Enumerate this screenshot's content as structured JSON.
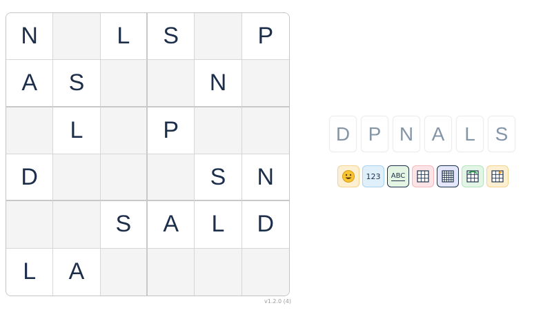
{
  "grid": [
    [
      "N",
      "",
      "L",
      "S",
      "",
      "P"
    ],
    [
      "A",
      "S",
      "",
      "",
      "N",
      ""
    ],
    [
      "",
      "L",
      "",
      "P",
      "",
      ""
    ],
    [
      "D",
      "",
      "",
      "",
      "S",
      "N"
    ],
    [
      "",
      "",
      "S",
      "A",
      "L",
      "D"
    ],
    [
      "L",
      "A",
      "",
      "",
      "",
      ""
    ]
  ],
  "letter_bank": [
    "D",
    "P",
    "N",
    "A",
    "L",
    "S"
  ],
  "tools": [
    {
      "name": "emoji-mode-button",
      "icon": "smiley-icon",
      "label": "",
      "bg": "#fdf0d2",
      "border": "#f2d38f"
    },
    {
      "name": "number-mode-button",
      "icon": "number-text",
      "label": "123",
      "bg": "#dff0fb",
      "border": "#a9d2ef"
    },
    {
      "name": "letter-mode-button",
      "icon": "letter-text",
      "label": "ABC",
      "bg": "#e5f5e3",
      "border": "#1c2e4a"
    },
    {
      "name": "grid-small-button",
      "icon": "grid-icon",
      "label": "",
      "bg": "#fce3e6",
      "border": "#f1b8c0"
    },
    {
      "name": "grid-large-button",
      "icon": "grid-dense-icon",
      "label": "",
      "bg": "#e4e6fa",
      "border": "#1c2e4a"
    },
    {
      "name": "grid-refresh-button",
      "icon": "grid-refresh-icon",
      "label": "",
      "bg": "#e3f6e6",
      "border": "#b2e2bb"
    },
    {
      "name": "grid-sparkle-button",
      "icon": "grid-sparkle-icon",
      "label": "",
      "bg": "#fdf0d2",
      "border": "#f2d38f"
    }
  ],
  "version": "v1.2.0 (4)"
}
